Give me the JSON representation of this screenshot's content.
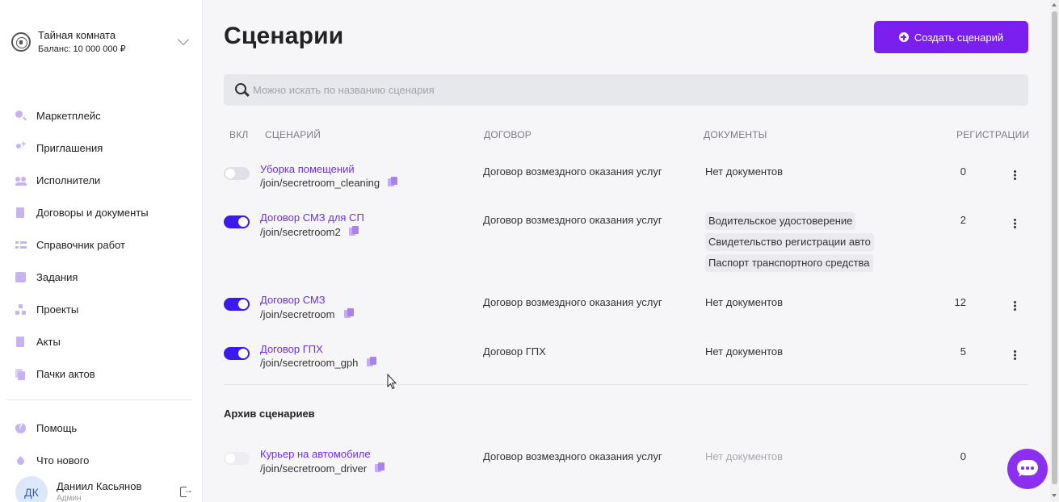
{
  "org": {
    "name": "Тайная комната",
    "balance": "Баланс: 10 000 000 ₽"
  },
  "nav": [
    {
      "id": "marketplace",
      "label": "Маркетплейс",
      "icon": "search-icon"
    },
    {
      "id": "invites",
      "label": "Приглашения",
      "icon": "user-plus-icon"
    },
    {
      "id": "executors",
      "label": "Исполнители",
      "icon": "users-icon"
    },
    {
      "id": "contracts",
      "label": "Договоры и документы",
      "icon": "document-icon"
    },
    {
      "id": "works",
      "label": "Справочник работ",
      "icon": "list-icon"
    },
    {
      "id": "tasks",
      "label": "Задания",
      "icon": "square-icon"
    },
    {
      "id": "projects",
      "label": "Проекты",
      "icon": "tree-icon"
    },
    {
      "id": "acts",
      "label": "Акты",
      "icon": "document-icon"
    },
    {
      "id": "act-packs",
      "label": "Пачки актов",
      "icon": "documents-icon"
    }
  ],
  "nav_secondary": [
    {
      "id": "help",
      "label": "Помощь",
      "icon": "help-icon"
    },
    {
      "id": "whats-new",
      "label": "Что нового",
      "icon": "drop-icon"
    }
  ],
  "user": {
    "initials": "ДК",
    "name": "Даниил Касьянов",
    "role": "Админ"
  },
  "page": {
    "title": "Сценарии",
    "create_button": "Создать сценарий",
    "search_placeholder": "Можно искать по названию сценария",
    "archive_title": "Архив сценариев"
  },
  "table": {
    "headers": {
      "enabled": "ВКЛ",
      "scenario": "СЦЕНАРИЙ",
      "contract": "ДОГОВОР",
      "documents": "ДОКУМЕНТЫ",
      "registrations": "РЕГИСТРАЦИИ"
    },
    "rows": [
      {
        "enabled": false,
        "name": "Уборка помещений",
        "link": "/join/secretroom_cleaning",
        "contract": "Договор возмездного оказания услуг",
        "documents": [],
        "no_docs": "Нет документов",
        "registrations": "0"
      },
      {
        "enabled": true,
        "name": "Договор СМЗ для СП",
        "link": "/join/secretroom2",
        "contract": "Договор возмездного оказания услуг",
        "documents": [
          "Водительское удостоверение",
          "Свидетельство регистрации авто",
          "Паспорт транспортного средства"
        ],
        "no_docs": "",
        "registrations": "2"
      },
      {
        "enabled": true,
        "name": "Договор СМЗ",
        "link": "/join/secretroom",
        "contract": "Договор возмездного оказания услуг",
        "documents": [],
        "no_docs": "Нет документов",
        "registrations": "12"
      },
      {
        "enabled": true,
        "name": "Договор ГПХ",
        "link": "/join/secretroom_gph",
        "contract": "Договор ГПХ",
        "documents": [],
        "no_docs": "Нет документов",
        "registrations": "5"
      }
    ],
    "archive_rows": [
      {
        "enabled": false,
        "name": "Курьер на автомобиле",
        "link": "/join/secretroom_driver",
        "contract": "Договор возмездного оказания услуг",
        "documents": [],
        "no_docs": "Нет документов",
        "registrations": "0"
      }
    ]
  },
  "colors": {
    "accent": "#7a1ff0",
    "toggle_on": "#3b1af0",
    "link": "#6b2ef0",
    "chat": "#8b2ff0"
  }
}
